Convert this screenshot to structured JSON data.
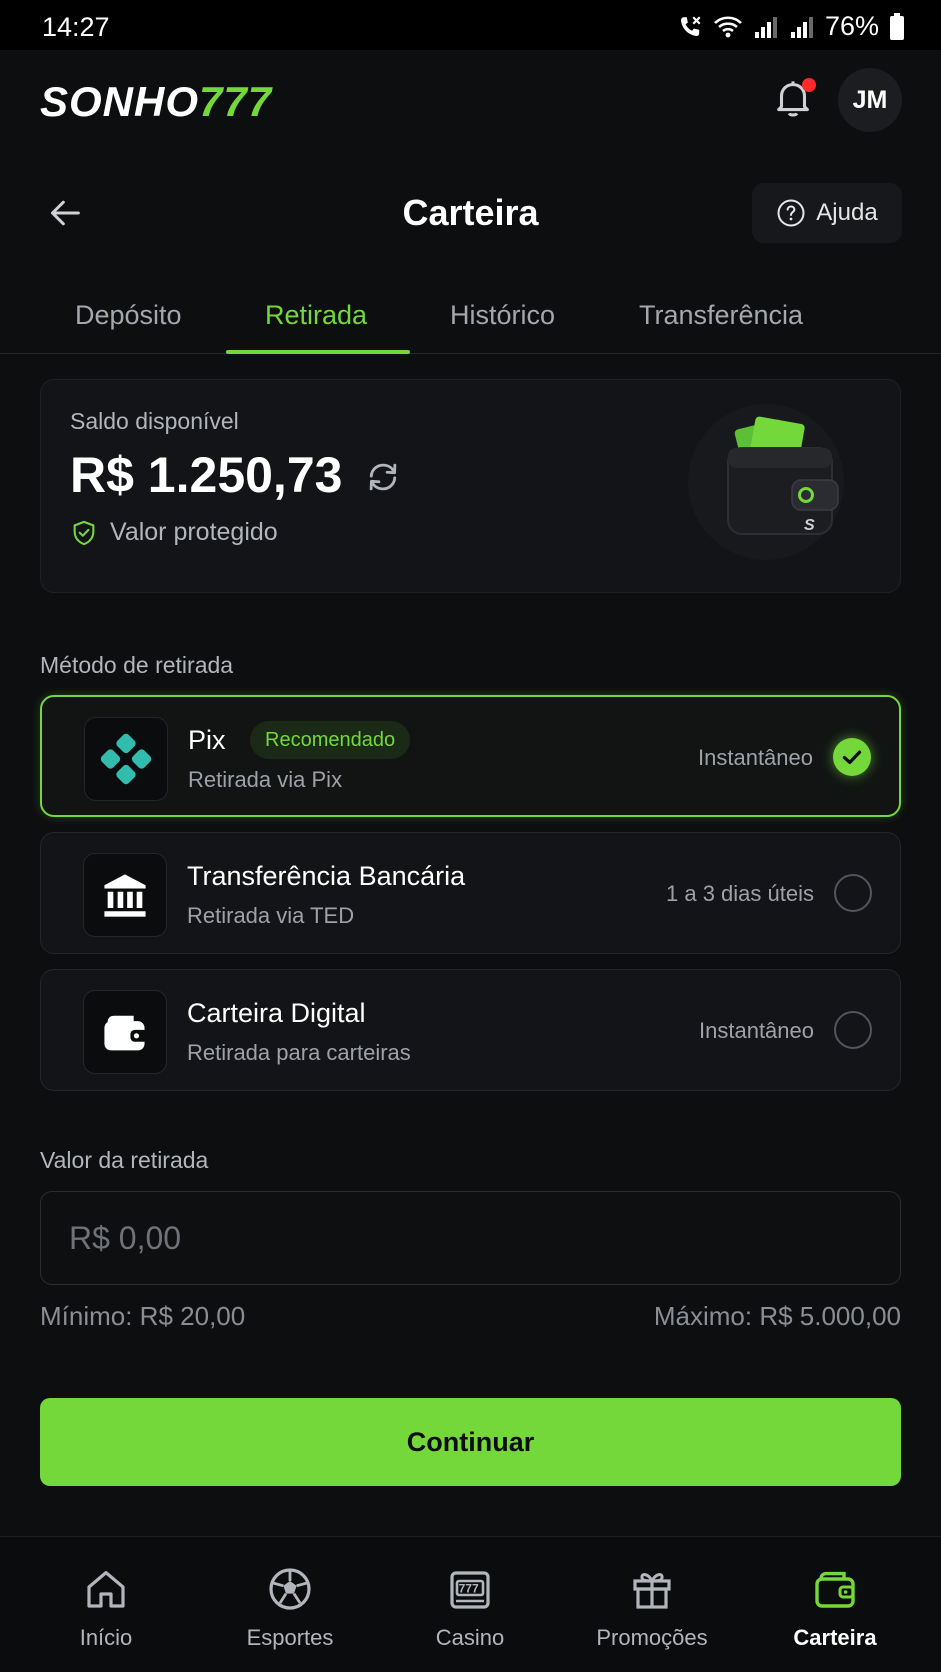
{
  "status_bar": {
    "time": "14:27",
    "battery": "76%"
  },
  "header": {
    "logo_part1": "SONHO",
    "logo_part2": "777",
    "avatar_initials": "JM"
  },
  "page": {
    "title": "Carteira",
    "help_label": "Ajuda"
  },
  "tabs": [
    {
      "label": "Depósito"
    },
    {
      "label": "Retirada",
      "active": true
    },
    {
      "label": "Histórico"
    },
    {
      "label": "Transferência"
    }
  ],
  "balance": {
    "label": "Saldo disponível",
    "value": "R$ 1.250,73",
    "protected_label": "Valor protegido"
  },
  "methods_section_label": "Método de retirada",
  "methods": [
    {
      "title": "Pix",
      "subtitle": "Retirada via Pix",
      "badge": "Recomendado",
      "time": "Instantâneo",
      "selected": true
    },
    {
      "title": "Transferência Bancária",
      "subtitle": "Retirada via TED",
      "time": "1 a 3 dias úteis",
      "selected": false
    },
    {
      "title": "Carteira Digital",
      "subtitle": "Retirada para carteiras",
      "time": "Instantâneo",
      "selected": false
    }
  ],
  "amount": {
    "label": "Valor da retirada",
    "placeholder": "R$ 0,00",
    "min_label": "Mínimo: R$ 20,00",
    "max_label": "Máximo: R$ 5.000,00"
  },
  "continue_label": "Continuar",
  "bottom_nav": [
    {
      "label": "Início",
      "icon": "home-icon"
    },
    {
      "label": "Esportes",
      "icon": "soccer-ball-icon"
    },
    {
      "label": "Casino",
      "icon": "slot-machine-icon"
    },
    {
      "label": "Promoções",
      "icon": "gift-icon"
    },
    {
      "label": "Carteira",
      "icon": "wallet-icon",
      "active": true
    }
  ],
  "colors": {
    "accent": "#74d83a",
    "background": "#0d0e10",
    "card": "#131417",
    "notification": "#ff2a2a",
    "pix": "#32bcad"
  }
}
